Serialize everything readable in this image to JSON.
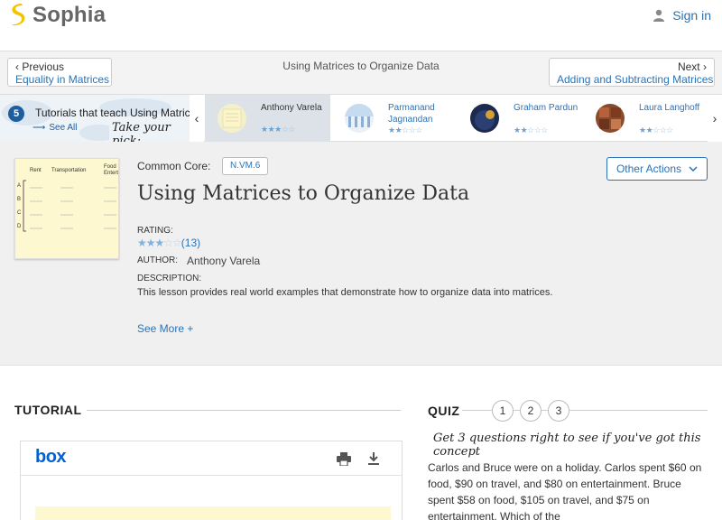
{
  "header": {
    "brand": "Sophia",
    "signin_label": "Sign in",
    "accent": "#2a73b6"
  },
  "nav": {
    "prev_label": "Previous",
    "prev_link": "Equality in Matrices",
    "title": "Using Matrices to Organize Data",
    "next_label": "Next",
    "next_link": "Adding and Subtracting Matrices"
  },
  "strip": {
    "count": "5",
    "heading": "Tutorials that teach Using Matrices to Organize Data",
    "see_all": "See All",
    "take_pick": "Take your pick:",
    "cards": [
      {
        "name": "Anthony Varela",
        "rating": 3,
        "active": true
      },
      {
        "name": "Parmanand Jagnandan",
        "rating": 2,
        "active": false
      },
      {
        "name": "Graham Pardun",
        "rating": 2,
        "active": false
      },
      {
        "name": "Laura Langhoff",
        "rating": 2,
        "active": false
      }
    ]
  },
  "lesson": {
    "thumb_headers": [
      "Rent",
      "Transportation",
      "Food Entertainment"
    ],
    "thumb_rows": [
      "A",
      "B",
      "C",
      "D"
    ],
    "common_core_label": "Common Core:",
    "standard": "N.VM.6",
    "other_actions": "Other Actions",
    "title": "Using Matrices to Organize Data",
    "rating_label": "RATING:",
    "rating_count": "(13)",
    "rating_value": 3,
    "author_label": "AUTHOR:",
    "author": "Anthony Varela",
    "description_label": "DESCRIPTION:",
    "description": "This lesson provides real world examples that demonstrate how to organize data into matrices.",
    "see_more": "See More +"
  },
  "tutorial": {
    "heading": "TUTORIAL",
    "viewer_brand": "box"
  },
  "quiz": {
    "heading": "QUIZ",
    "numbers": [
      "1",
      "2",
      "3"
    ],
    "hint": "Get 3 questions right to see if you've got this concept",
    "question": "Carlos and Bruce were on a holiday. Carlos spent $60 on food, $90 on travel, and $80 on entertainment. Bruce spent $58 on food, $105 on travel, and $75 on entertainment. Which of the"
  }
}
